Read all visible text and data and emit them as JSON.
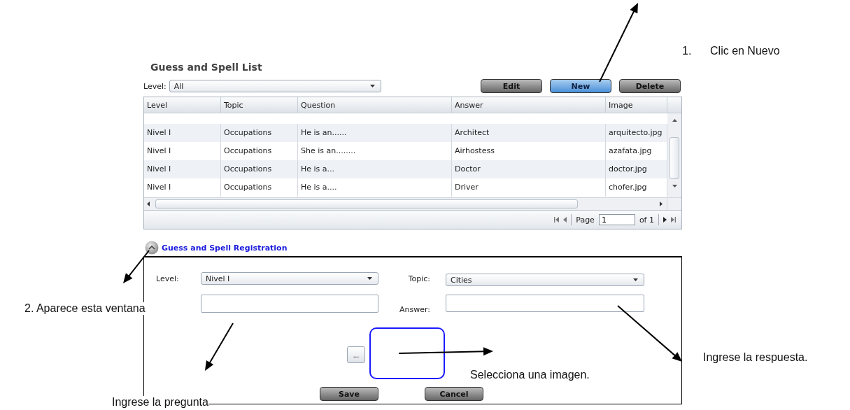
{
  "list": {
    "title": "Guess and Spell List",
    "level_filter": {
      "label": "Level:",
      "value": "All"
    },
    "buttons": [
      {
        "label": "Edit",
        "highlighted": false
      },
      {
        "label": "New",
        "highlighted": true
      },
      {
        "label": "Delete",
        "highlighted": false
      }
    ],
    "columns": [
      "Level",
      "Topic",
      "Question",
      "Answer",
      "Image"
    ],
    "rows": [
      {
        "cells": [
          "Nivel I",
          "Occupations",
          "He is an......",
          "Architect",
          "arquitecto.jpg"
        ]
      },
      {
        "cells": [
          "Nivel I",
          "Occupations",
          "She is an........",
          "Airhostess",
          "azafata.jpg"
        ]
      },
      {
        "cells": [
          "Nivel I",
          "Occupations",
          "He is a...",
          "Doctor",
          "doctor.jpg"
        ]
      },
      {
        "cells": [
          "Nivel I",
          "Occupations",
          "He is a....",
          "Driver",
          "chofer.jpg"
        ]
      }
    ],
    "pager": {
      "page_label": "Page",
      "page_value": "1",
      "total": "of 1"
    }
  },
  "registration": {
    "title": "Guess and Spell Registration",
    "level": {
      "label": "Level:",
      "value": "Nivel I"
    },
    "topic": {
      "label": "Topic:",
      "value": "Cities"
    },
    "answer": {
      "label": "Answer:"
    },
    "browse_button": "...",
    "buttons": [
      "Save",
      "Cancel"
    ]
  },
  "annotations": [
    "1.      Clic en Nuevo",
    "2. Aparece esta ventana",
    "Ingrese la pregunta",
    "Selecciona una imagen.",
    "Ingrese la respuesta."
  ]
}
